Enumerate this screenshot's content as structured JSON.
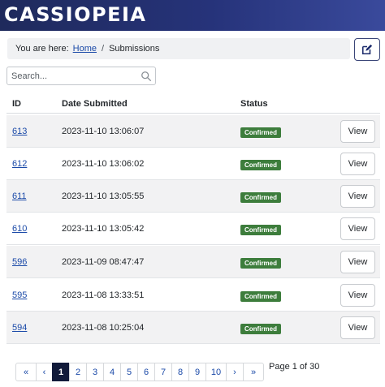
{
  "app": {
    "logo": "CASSIOPEIA"
  },
  "breadcrumb": {
    "prefix": "You are here:",
    "home": "Home",
    "separator": "/",
    "current": "Submissions"
  },
  "search": {
    "placeholder": "Search..."
  },
  "table": {
    "headers": {
      "id": "ID",
      "date": "Date Submitted",
      "status": "Status"
    },
    "rows": [
      {
        "id": "613",
        "date": "2023-11-10 13:06:07",
        "status": "Confirmed",
        "action": "View"
      },
      {
        "id": "612",
        "date": "2023-11-10 13:06:02",
        "status": "Confirmed",
        "action": "View"
      },
      {
        "id": "611",
        "date": "2023-11-10 13:05:55",
        "status": "Confirmed",
        "action": "View"
      },
      {
        "id": "610",
        "date": "2023-11-10 13:05:42",
        "status": "Confirmed",
        "action": "View"
      },
      {
        "id": "596",
        "date": "2023-11-09 08:47:47",
        "status": "Confirmed",
        "action": "View"
      },
      {
        "id": "595",
        "date": "2023-11-08 13:33:51",
        "status": "Confirmed",
        "action": "View"
      },
      {
        "id": "594",
        "date": "2023-11-08 10:25:04",
        "status": "Confirmed",
        "action": "View"
      }
    ]
  },
  "pagination": {
    "first": "«",
    "prev": "‹",
    "pages": [
      "1",
      "2",
      "3",
      "4",
      "5",
      "6",
      "7",
      "8",
      "9",
      "10"
    ],
    "next": "›",
    "last": "»",
    "status": "Page 1 of 30",
    "current": 1
  },
  "colors": {
    "header": "#26337a",
    "link": "#1b4aa8",
    "badge": "#3d7d3c",
    "active_page": "#111a3a"
  },
  "icons": {
    "edit": "pencil-square-icon",
    "search": "search-icon"
  }
}
